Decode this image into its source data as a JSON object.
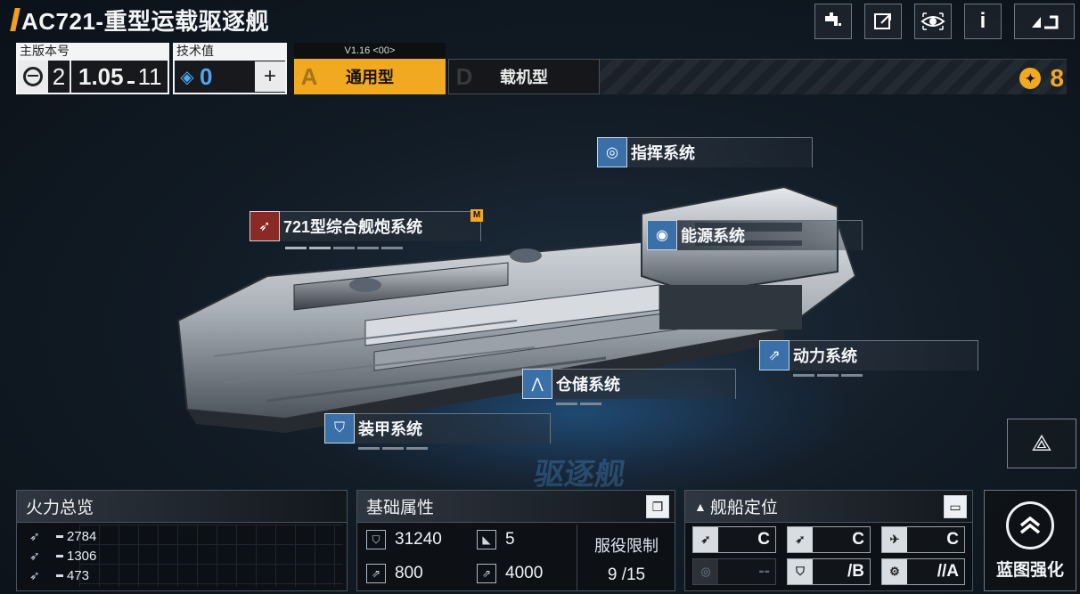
{
  "title": "AC721-重型运载驱逐舰",
  "top_buttons": [
    "faucet-icon",
    "share-icon",
    "eye-icon",
    "info-icon",
    "back-icon"
  ],
  "version": {
    "label": "主版本号",
    "major": "2",
    "number": "1.05",
    "sub": "11"
  },
  "tech": {
    "label": "技术值",
    "value": "0",
    "add_icon": "plus-icon"
  },
  "tabs": {
    "active_header": "V1.16 <00>",
    "a_letter": "A",
    "a_name": "通用型",
    "d_letter": "D",
    "d_name": "载机型"
  },
  "currency": {
    "value": "8",
    "color": "#f2a922"
  },
  "systems": [
    {
      "name": "指挥系统",
      "icon": "radar-icon"
    },
    {
      "name": "721型综合舰炮系统",
      "icon": "shell-icon",
      "badge": "M"
    },
    {
      "name": "能源系统",
      "icon": "energy-icon"
    },
    {
      "name": "动力系统",
      "icon": "engine-icon"
    },
    {
      "name": "仓储系统",
      "icon": "cargo-icon"
    },
    {
      "name": "装甲系统",
      "icon": "shield-icon"
    }
  ],
  "holo_text": "驱逐舰",
  "firepower": {
    "title": "火力总览",
    "rows": [
      "2784",
      "1306",
      "473"
    ]
  },
  "base_stats": {
    "title": "基础属性",
    "hp": "31240",
    "armor": "5",
    "speed": "800",
    "range": "4000",
    "service_label": "服役限制",
    "service_value": "9 /15"
  },
  "positioning": {
    "title": "舰船定位",
    "cells": [
      {
        "grade": "C",
        "icon": "missile-icon"
      },
      {
        "grade": "C",
        "icon": "missile-icon"
      },
      {
        "grade": "C",
        "icon": "drone-icon"
      },
      {
        "grade": "--",
        "icon": "target-icon",
        "dim": true
      },
      {
        "grade": "/B",
        "icon": "shield-icon"
      },
      {
        "grade": "//A",
        "icon": "gear-icon"
      }
    ]
  },
  "blueprint": {
    "label": "蓝图强化",
    "icon": "chevrons-up-icon"
  },
  "accent_color": "#f2a922"
}
